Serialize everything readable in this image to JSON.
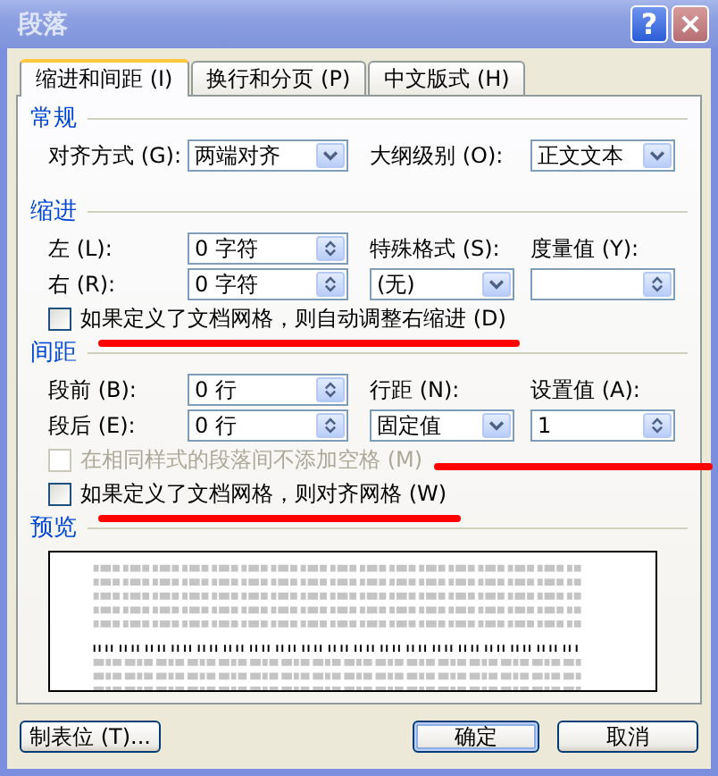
{
  "window": {
    "title": "段落",
    "help_button": "?"
  },
  "tabs": [
    {
      "label": "缩进和间距 (I)",
      "selected": true
    },
    {
      "label": "换行和分页 (P)",
      "selected": false
    },
    {
      "label": "中文版式 (H)",
      "selected": false
    }
  ],
  "general": {
    "heading": "常规",
    "alignment": {
      "label": "对齐方式 (G):",
      "value": "两端对齐"
    },
    "outline_level": {
      "label": "大纲级别 (O):",
      "value": "正文文本"
    }
  },
  "indent": {
    "heading": "缩进",
    "left": {
      "label": "左 (L):",
      "value": "0 字符"
    },
    "right": {
      "label": "右 (R):",
      "value": "0 字符"
    },
    "special": {
      "label": "特殊格式 (S):",
      "value": "(无)"
    },
    "by": {
      "label": "度量值 (Y):"
    },
    "checkboxes": [
      {
        "label": "如果定义了文档网格，则自动调整右缩进 (D)",
        "checked": false,
        "disabled": false,
        "underlined": true
      }
    ]
  },
  "spacing": {
    "heading": "间距",
    "before": {
      "label": "段前 (B):",
      "value": "0 行"
    },
    "after": {
      "label": "段后 (E):",
      "value": "0 行"
    },
    "line_spacing": {
      "label": "行距 (N):",
      "value": "固定值"
    },
    "at": {
      "label": "设置值 (A):",
      "value": "1"
    },
    "checkboxes": [
      {
        "label": "在相同样式的段落间不添加空格 (M)",
        "checked": false,
        "disabled": true,
        "struck_beside": true
      },
      {
        "label": "如果定义了文档网格，则对齐网格 (W)",
        "checked": false,
        "disabled": false,
        "underlined": true
      }
    ]
  },
  "preview": {
    "heading": "预览"
  },
  "buttons": [
    {
      "label": "制表位 (T)...",
      "kind": "plain"
    },
    {
      "label": "确定",
      "kind": "default"
    },
    {
      "label": "取消",
      "kind": "plain"
    }
  ]
}
